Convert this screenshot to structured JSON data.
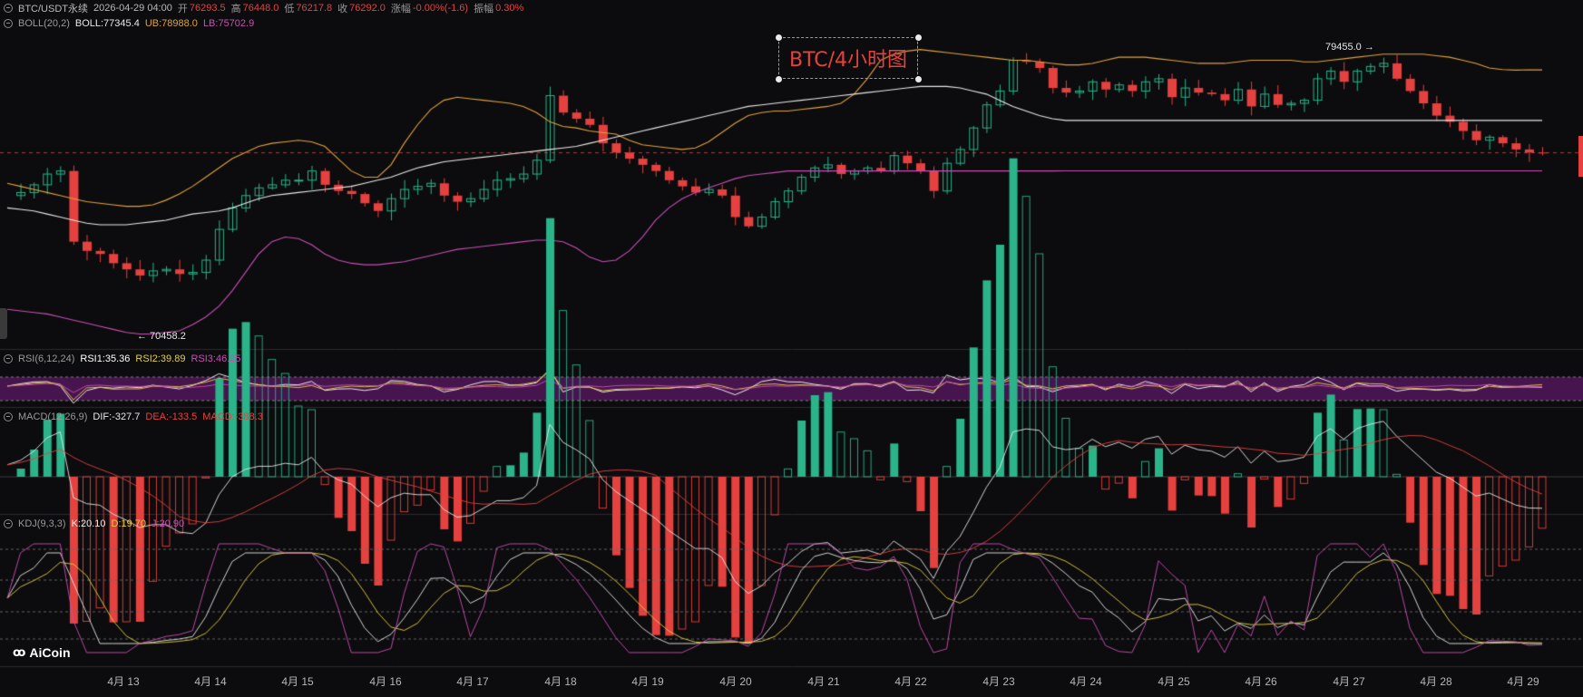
{
  "header": {
    "symbol": "BTC/USDT永续",
    "datetime": "2026-04-29 04:00",
    "open_label": "开",
    "open": "76293.5",
    "high_label": "高",
    "high": "76448.0",
    "low_label": "低",
    "low": "76217.8",
    "close_label": "收",
    "close": "76292.0",
    "change_label": "涨幅",
    "change": "-0.00%(-1.6)",
    "amplitude_label": "振幅",
    "amplitude": "0.30%"
  },
  "boll": {
    "name": "BOLL(20,2)",
    "mid": "BOLL:77345.4",
    "ub": "UB:78988.0",
    "lb": "LB:75702.9"
  },
  "rsi": {
    "name": "RSI(6,12,24)",
    "rsi1": "RSI1:35.36",
    "rsi2": "RSI2:39.89",
    "rsi3": "RSI3:46.25"
  },
  "macd": {
    "name": "MACD(12,26,9)",
    "dif": "DIF:-327.7",
    "dea": "DEA:-133.5",
    "macd": "MACD:-388.3"
  },
  "kdj": {
    "name": "KDJ(9,3,3)",
    "k": "K:20.10",
    "d": "D:19.70",
    "j": "J:20.90"
  },
  "title": "BTC/4小时图",
  "annotations": {
    "low": "← 70458.2",
    "high": "79455.0 →"
  },
  "x_axis": [
    "4月 13",
    "4月 14",
    "4月 15",
    "4月 16",
    "4月 17",
    "4月 18",
    "4月 19",
    "4月 20",
    "4月 21",
    "4月 22",
    "4月 23",
    "4月 24",
    "4月 25",
    "4月 26",
    "4月 27",
    "4月 28",
    "4月 29"
  ],
  "logo": "AiCoin",
  "colors": {
    "up": "#2bb38a",
    "down": "#e5413f",
    "boll_mid": "#e8e8e8",
    "boll_ub": "#e2a23a",
    "boll_lb": "#c94fb4",
    "rsi1": "#ffffff",
    "rsi2": "#e4d041",
    "rsi3": "#c94fb4",
    "dif": "#e8e8e8",
    "dea": "#e5413f",
    "k": "#e8e8e8",
    "d": "#e4d041",
    "j": "#c94fb4"
  },
  "chart_data": {
    "type": "candlestick",
    "interval": "4h",
    "price_range": [
      70000,
      80200
    ],
    "closes": [
      74900,
      75000,
      75250,
      75600,
      75700,
      73400,
      73100,
      73000,
      72700,
      72500,
      72300,
      72450,
      72500,
      72350,
      72400,
      72800,
      73800,
      74500,
      74900,
      75150,
      75250,
      75400,
      75400,
      75700,
      75250,
      75050,
      74950,
      74650,
      74400,
      74800,
      75100,
      75200,
      75300,
      74900,
      74700,
      74800,
      75100,
      75400,
      75450,
      75600,
      76050,
      78150,
      77600,
      77400,
      77200,
      76600,
      76300,
      76100,
      75900,
      75700,
      75400,
      75200,
      75000,
      75100,
      74900,
      74200,
      73900,
      74200,
      74700,
      75050,
      75500,
      75800,
      75900,
      75600,
      75700,
      75800,
      75700,
      76200,
      75950,
      75700,
      75050,
      75950,
      76400,
      77100,
      77850,
      78300,
      79300,
      79250,
      79050,
      78400,
      78250,
      78300,
      78600,
      78350,
      78500,
      78300,
      78600,
      78700,
      78100,
      78400,
      78250,
      78200,
      78000,
      78350,
      77800,
      78200,
      77850,
      77900,
      78000,
      78700,
      78950,
      78600,
      78950,
      79100,
      79200,
      78700,
      78300,
      77900,
      77500,
      77300,
      77000,
      76700,
      76800,
      76600,
      76400,
      76300,
      76292
    ],
    "boll_ub": [
      75300,
      75200,
      75100,
      75000,
      74900,
      74800,
      74700,
      74650,
      74600,
      74550,
      74550,
      74600,
      74750,
      74950,
      75200,
      75500,
      75800,
      76100,
      76300,
      76500,
      76600,
      76650,
      76700,
      76650,
      76500,
      76100,
      75700,
      75500,
      75500,
      75900,
      76600,
      77200,
      77700,
      78000,
      78100,
      78050,
      78000,
      77950,
      77900,
      77800,
      77600,
      77300,
      77150,
      77100,
      77000,
      76950,
      76900,
      76700,
      76550,
      76500,
      76450,
      76400,
      76450,
      76650,
      76950,
      77250,
      77500,
      77600,
      77650,
      77650,
      77700,
      77750,
      77800,
      77900,
      78200,
      78700,
      79300,
      79500,
      79600,
      79650,
      79600,
      79550,
      79500,
      79450,
      79400,
      79350,
      79300,
      79300,
      79250,
      79200,
      79150,
      79150,
      79200,
      79300,
      79400,
      79400,
      79400,
      79350,
      79300,
      79250,
      79200,
      79200,
      79200,
      79250,
      79300,
      79300,
      79300,
      79300,
      79250,
      79250,
      79300,
      79350,
      79400,
      79450,
      79500,
      79500,
      79500,
      79500,
      79450,
      79400,
      79300,
      79200,
      79050,
      79000,
      78980,
      78990,
      78988
    ],
    "boll_mid": [
      74500,
      74450,
      74400,
      74300,
      74200,
      74100,
      74000,
      73950,
      73950,
      73950,
      74000,
      74050,
      74100,
      74200,
      74300,
      74350,
      74400,
      74500,
      74650,
      74800,
      74900,
      74950,
      75000,
      75050,
      75100,
      75150,
      75200,
      75300,
      75400,
      75500,
      75650,
      75800,
      75900,
      76000,
      76050,
      76100,
      76150,
      76200,
      76250,
      76300,
      76350,
      76400,
      76450,
      76500,
      76600,
      76700,
      76800,
      76900,
      77000,
      77100,
      77200,
      77300,
      77400,
      77500,
      77600,
      77700,
      77800,
      77850,
      77900,
      77950,
      78000,
      78050,
      78100,
      78150,
      78200,
      78250,
      78300,
      78350,
      78400,
      78450,
      78450,
      78450,
      78400,
      78300,
      78200,
      78000,
      77800,
      77650,
      77500,
      77400,
      77345,
      77345,
      77345,
      77345,
      77345,
      77345,
      77345,
      77345,
      77345,
      77345,
      77345,
      77345,
      77345,
      77345,
      77345,
      77345,
      77345,
      77345,
      77345,
      77345,
      77345,
      77345,
      77345,
      77345,
      77345,
      77345,
      77345,
      77345,
      77345,
      77345,
      77345,
      77345,
      77345,
      77345,
      77345,
      77345,
      77345
    ],
    "boll_lb": [
      71200,
      71150,
      71100,
      71050,
      70950,
      70850,
      70750,
      70650,
      70550,
      70450,
      70400,
      70400,
      70450,
      70500,
      70700,
      70950,
      71300,
      71800,
      72400,
      73000,
      73400,
      73550,
      73500,
      73300,
      73000,
      72800,
      72700,
      72650,
      72650,
      72700,
      72750,
      72850,
      72950,
      73050,
      73150,
      73200,
      73250,
      73300,
      73350,
      73400,
      73450,
      73450,
      73400,
      73200,
      72900,
      72750,
      72800,
      73100,
      73550,
      74100,
      74500,
      74800,
      75000,
      75150,
      75300,
      75450,
      75550,
      75600,
      75650,
      75700,
      75700,
      75700,
      75700,
      75700,
      75700,
      75700,
      75700,
      75700,
      75700,
      75700,
      75700,
      75700,
      75700,
      75700,
      75700,
      75700,
      75700,
      75700,
      75700,
      75700,
      75703,
      75703,
      75703,
      75703,
      75703,
      75703,
      75703,
      75703,
      75703,
      75703,
      75703,
      75703,
      75703,
      75703,
      75703,
      75703,
      75703,
      75703,
      75703,
      75703,
      75703,
      75703,
      75703,
      75703,
      75703,
      75703,
      75703,
      75703,
      75703,
      75703,
      75703,
      75703,
      75703,
      75703,
      75703,
      75703,
      75703
    ],
    "note_last": {
      "close": 76292.0,
      "boll": 77345.4,
      "ub": 78988.0,
      "lb": 75702.9
    },
    "low_marker": 70458.2,
    "high_marker": 79455.0
  }
}
